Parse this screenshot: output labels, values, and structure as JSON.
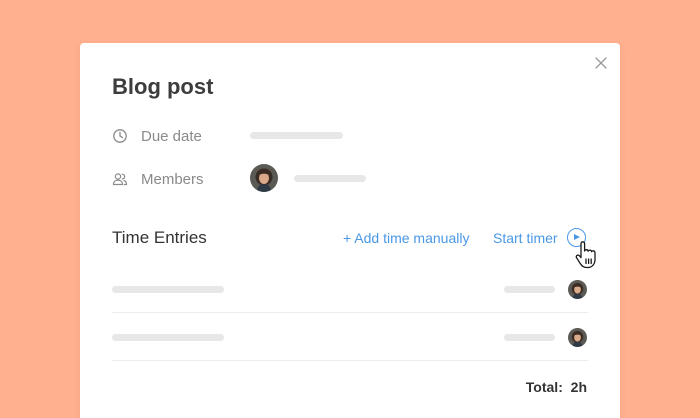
{
  "dialog": {
    "title": "Blog post",
    "due_date_label": "Due date",
    "members_label": "Members",
    "time_entries": {
      "title": "Time Entries",
      "add_manual_label": "+ Add time manually",
      "start_timer_label": "Start timer",
      "total_label": "Total:",
      "total_value": "2h"
    }
  },
  "icons": {
    "close": "close-icon",
    "due_date": "clock-icon",
    "members": "people-icon",
    "play": "play-icon",
    "cursor": "hand-pointer-icon"
  },
  "colors": {
    "background": "#ffb08e",
    "accent": "#4a98e6",
    "skeleton": "#e7e7e7"
  }
}
